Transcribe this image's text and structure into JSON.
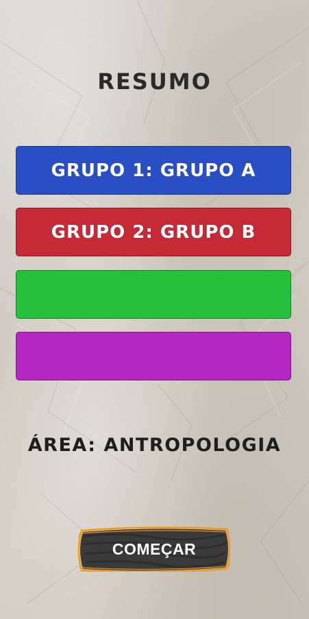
{
  "summary": {
    "title": "RESUMO"
  },
  "groups": [
    {
      "label": "GRUPO 1: GRUPO A",
      "color": "#2a4fc5"
    },
    {
      "label": "GRUPO 2: GRUPO B",
      "color": "#c52a36"
    },
    {
      "label": "",
      "color": "#27c03b"
    },
    {
      "label": "",
      "color": "#b427c3"
    }
  ],
  "area": {
    "label": "ÁREA: ANTROPOLOGIA"
  },
  "start": {
    "label": "COMEÇAR",
    "outline_color": "#f09a1c",
    "fill_color": "#3a3a3a"
  }
}
